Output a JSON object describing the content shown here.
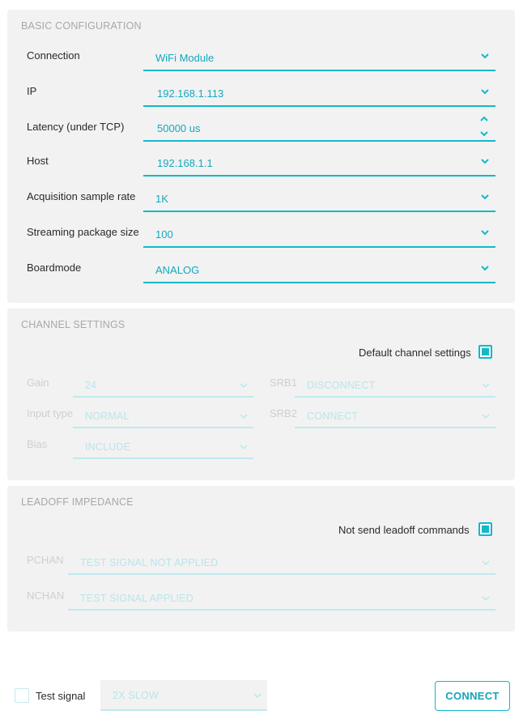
{
  "basic": {
    "title": "BASIC CONFIGURATION",
    "rows": [
      {
        "label": "Connection",
        "value": "WiFi Module"
      },
      {
        "label": "IP",
        "value": "192.168.1.113"
      },
      {
        "label": "Latency (under TCP)",
        "value": "50000 us"
      },
      {
        "label": "Host",
        "value": "192.168.1.1"
      },
      {
        "label": "Acquisition sample rate",
        "value": "1K"
      },
      {
        "label": "Streaming package size",
        "value": "100"
      },
      {
        "label": "Boardmode",
        "value": "ANALOG"
      }
    ]
  },
  "channel": {
    "title": "CHANNEL SETTINGS",
    "default_label": "Default channel settings",
    "default_checked": true,
    "gain_label": "Gain",
    "gain_value": "24",
    "srb1_label": "SRB1",
    "srb1_value": "DISCONNECT",
    "input_label": "Input type",
    "input_value": "NORMAL",
    "srb2_label": "SRB2",
    "srb2_value": "CONNECT",
    "bias_label": "Bias",
    "bias_value": "INCLUDE"
  },
  "leadoff": {
    "title": "LEADOFF IMPEDANCE",
    "not_send_label": "Not send leadoff commands",
    "not_send_checked": true,
    "pchan_label": "PCHAN",
    "pchan_value": "TEST SIGNAL NOT APPLIED",
    "nchan_label": "NCHAN",
    "nchan_value": "TEST SIGNAL APPLIED"
  },
  "footer": {
    "test_signal_label": "Test signal",
    "test_signal_checked": false,
    "speed_value": "2X SLOW",
    "connect_label": "CONNECT"
  },
  "colors": {
    "accent": "#14b8c8",
    "panel": "#f2f2f2",
    "disabled": "#bfe9ee"
  },
  "icons": {
    "dropdown": "chevron-down-icon",
    "spinner": "spinner-icon"
  }
}
